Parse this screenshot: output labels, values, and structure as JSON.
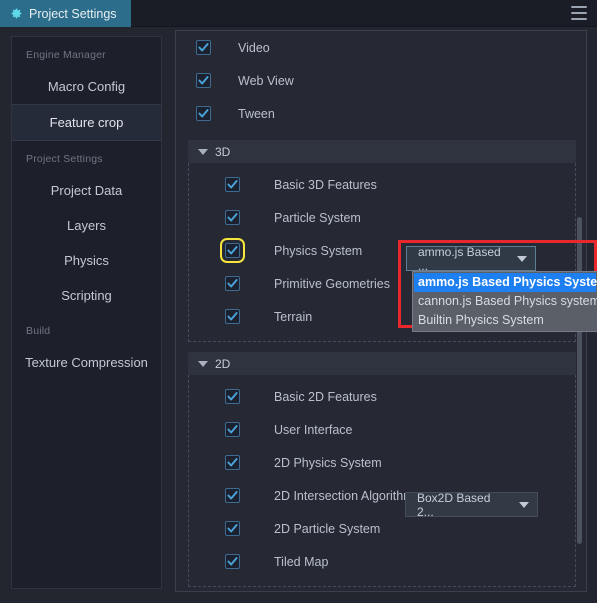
{
  "window": {
    "tab_title": "Project Settings",
    "gear_icon": "gear-icon",
    "menu_icon": "hamburger-menu-icon"
  },
  "sidebar": {
    "groups": [
      {
        "title": "Engine Manager",
        "items": [
          {
            "label": "Macro Config",
            "active": false
          },
          {
            "label": "Feature crop",
            "active": true
          }
        ]
      },
      {
        "title": "Project Settings",
        "items": [
          {
            "label": "Project Data",
            "active": false
          },
          {
            "label": "Layers",
            "active": false
          },
          {
            "label": "Physics",
            "active": false
          },
          {
            "label": "Scripting",
            "active": false
          }
        ]
      },
      {
        "title": "Build",
        "items": [
          {
            "label": "Texture Compression",
            "active": false
          }
        ]
      }
    ]
  },
  "content": {
    "top_items": [
      {
        "label": "Video",
        "checked": true
      },
      {
        "label": "Web View",
        "checked": true
      },
      {
        "label": "Tween",
        "checked": true
      }
    ],
    "group_3d": {
      "label": "3D",
      "expanded": true,
      "items": [
        {
          "label": "Basic 3D Features",
          "checked": true
        },
        {
          "label": "Particle System",
          "checked": true
        },
        {
          "label": "Physics System",
          "checked": true,
          "focused": true
        },
        {
          "label": "Primitive Geometries",
          "checked": true
        },
        {
          "label": "Terrain",
          "checked": true
        }
      ]
    },
    "group_2d": {
      "label": "2D",
      "expanded": true,
      "items": [
        {
          "label": "Basic 2D Features",
          "checked": true
        },
        {
          "label": "User Interface",
          "checked": true
        },
        {
          "label": "2D Physics System",
          "checked": true
        },
        {
          "label": "2D Intersection Algorithms",
          "checked": true
        },
        {
          "label": "2D Particle System",
          "checked": true
        },
        {
          "label": "Tiled Map",
          "checked": true
        }
      ]
    },
    "physics_select": {
      "value": "ammo.js Based ...",
      "open": true,
      "options": [
        {
          "label": "ammo.js Based Physics System",
          "selected": true
        },
        {
          "label": "cannon.js Based Physics system",
          "selected": false
        },
        {
          "label": "Builtin Physics System",
          "selected": false
        }
      ]
    },
    "physics_2d_select": {
      "value": "Box2D Based 2...",
      "open": false
    }
  },
  "colors": {
    "tab_accent": "#2b6d8b",
    "highlight_box": "#f5e53d",
    "annotation_box": "#e8282c",
    "option_selected": "#1d7ff0"
  }
}
